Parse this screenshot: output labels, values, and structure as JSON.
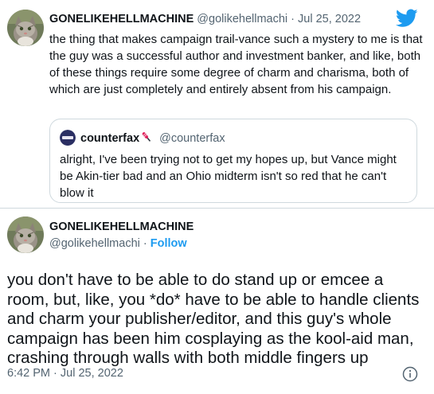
{
  "parent_tweet": {
    "author_name": "GONELIKEHELLMACHINE",
    "author_handle": "@golikehellmachi",
    "separator": "·",
    "date": "Jul 25, 2022",
    "text": "the thing that makes campaign trail-vance such a mystery to me is that the guy was a successful author and investment banker, and like, both of these things require some degree of charm and charisma, both of which are just completely and entirely absent from his campaign.",
    "quoted_tweet": {
      "author_name": "counterfax",
      "author_handle": "@counterfax",
      "name_icon": "microphone-icon",
      "text": "alright, I've been trying not to get my hopes up, but Vance might be Akin-tier bad and an Ohio midterm isn't so red that he can't blow it"
    }
  },
  "main_tweet": {
    "author_name": "GONELIKEHELLMACHINE",
    "author_handle": "@golikehellmachi",
    "separator": "·",
    "follow_label": "Follow",
    "text": "you don't have to be able to do stand up or emcee a room, but, like, you *do* have to be able to handle clients and charm your publisher/editor, and this guy's whole campaign has been him cosplaying as the kool-aid man, crashing through walls with both middle fingers up",
    "timestamp": "6:42 PM · Jul 25, 2022"
  },
  "icons": {
    "brand": "twitter-bird-icon",
    "info": "info-icon"
  },
  "colors": {
    "twitter_blue": "#1d9bf0",
    "text_primary": "#0f1419",
    "text_secondary": "#536471",
    "border": "#cfd9de"
  }
}
